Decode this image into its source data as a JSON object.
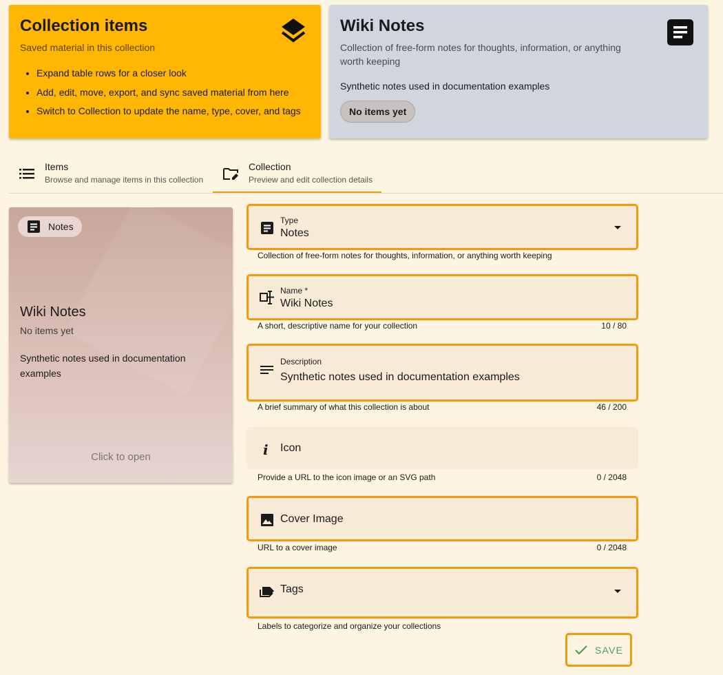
{
  "collection_items_card": {
    "title": "Collection items",
    "subtitle": "Saved material in this collection",
    "bullets": [
      "Expand table rows for a closer look",
      "Add, edit, move, export, and sync saved material from here",
      "Switch to Collection to update the name, type, cover, and tags"
    ],
    "icon": "layers-icon"
  },
  "wiki_card": {
    "title": "Wiki Notes",
    "subtitle": "Collection of free-form notes for thoughts, information, or anything worth keeping",
    "description": "Synthetic notes used in documentation examples",
    "chip": "No items yet",
    "icon": "note-icon"
  },
  "tabs": [
    {
      "label": "Items",
      "sub": "Browse and manage items in this collection",
      "icon": "list-icon"
    },
    {
      "label": "Collection",
      "sub": "Preview and edit collection details",
      "icon": "folder-edit-icon",
      "active": true
    }
  ],
  "preview": {
    "chip": "Notes",
    "title": "Wiki Notes",
    "count": "No items yet",
    "description": "Synthetic notes used in documentation examples",
    "open_hint": "Click to open"
  },
  "form": {
    "type": {
      "label": "Type",
      "value": "Notes",
      "hint": "Collection of free-form notes for thoughts, information, or anything worth keeping"
    },
    "name": {
      "label": "Name *",
      "value": "Wiki Notes",
      "hint": "A short, descriptive name for your collection",
      "counter": "10 / 80"
    },
    "description": {
      "label": "Description",
      "value": "Synthetic notes used in documentation examples",
      "hint": "A brief summary of what this collection is about",
      "counter": "46 / 200"
    },
    "icon": {
      "label": "Icon",
      "hint": "Provide a URL to the icon image or an SVG path",
      "counter": "0 / 2048"
    },
    "cover": {
      "label": "Cover Image",
      "hint": "URL to a cover image",
      "counter": "0 / 2048"
    },
    "tags": {
      "label": "Tags",
      "hint": "Labels to categorize and organize your collections"
    },
    "save_label": "SAVE"
  },
  "colors": {
    "accent": "#f29a0a",
    "yellow_card": "#ffb703",
    "grey_card": "#d1d6de",
    "background": "#fdf5e2",
    "save_green": "#4f9a55"
  }
}
